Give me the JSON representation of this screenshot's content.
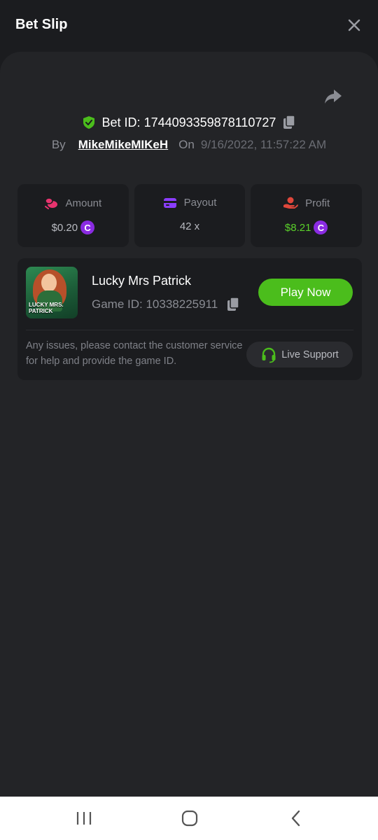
{
  "header": {
    "title": "Bet Slip"
  },
  "bet": {
    "id_label": "Bet ID:",
    "id": "1744093359878110727",
    "by_label": "By",
    "user": "MikeMikeMIKeH",
    "on_label": "On",
    "date": "9/16/2022, 11:57:22 AM"
  },
  "stats": {
    "amount_label": "Amount",
    "amount_value": "$0.20",
    "payout_label": "Payout",
    "payout_value": "42 x",
    "profit_label": "Profit",
    "profit_value": "$8.21",
    "coin_symbol": "C"
  },
  "game": {
    "thumb_text": "LUCKY MRS. PATRICK",
    "name": "Lucky Mrs Patrick",
    "id_text": "Game ID: 10338225911",
    "play_label": "Play Now",
    "help_text": "Any issues, please contact the customer service for help and provide the game ID.",
    "support_label": "Live Support"
  },
  "colors": {
    "accent_green": "#4bbd1c",
    "profit_green": "#5bd12a",
    "coin_purple": "#8a2be2",
    "amount_icon": "#e8336e",
    "payout_icon": "#8b3dff",
    "profit_icon": "#e0473b"
  },
  "icons": {
    "close": "close-icon",
    "share": "share-icon",
    "verified": "shield-check-icon",
    "copy": "copy-icon",
    "amount": "coins-icon",
    "payout": "wallet-icon",
    "profit": "hand-coin-icon",
    "support": "headset-icon"
  }
}
